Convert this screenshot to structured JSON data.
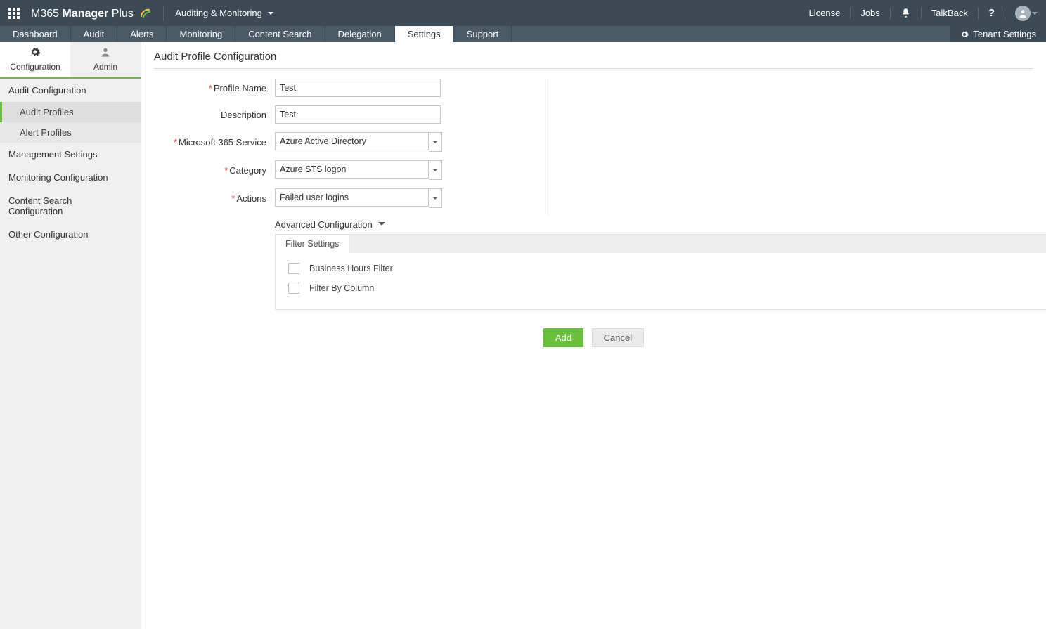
{
  "topbar": {
    "brand_pre": "M365 ",
    "brand_strong": "Manager",
    "brand_post": " Plus",
    "module": "Auditing & Monitoring",
    "license": "License",
    "jobs": "Jobs",
    "talkback": "TalkBack",
    "help": "?"
  },
  "navtabs": {
    "items": [
      "Dashboard",
      "Audit",
      "Alerts",
      "Monitoring",
      "Content Search",
      "Delegation",
      "Settings",
      "Support"
    ],
    "tenant": "Tenant Settings"
  },
  "sidetabs": {
    "configuration": "Configuration",
    "admin": "Admin"
  },
  "sidebar": {
    "audit_config": "Audit Configuration",
    "audit_profiles": "Audit Profiles",
    "alert_profiles": "Alert Profiles",
    "mgmt_settings": "Management Settings",
    "monitoring_config": "Monitoring Configuration",
    "content_search_config": "Content Search Configuration",
    "other_config": "Other Configuration"
  },
  "page": {
    "title": "Audit Profile Configuration"
  },
  "form": {
    "profile_name_label": "Profile Name",
    "profile_name_value": "Test",
    "description_label": "Description",
    "description_value": "Test",
    "service_label": "Microsoft 365 Service",
    "service_value": "Azure Active Directory",
    "category_label": "Category",
    "category_value": "Azure STS logon",
    "actions_label": "Actions",
    "actions_value": "Failed user logins",
    "advanced": "Advanced Configuration",
    "filter_tab": "Filter Settings",
    "business_hours": "Business Hours Filter",
    "filter_by_column": "Filter By Column"
  },
  "buttons": {
    "add": "Add",
    "cancel": "Cancel"
  }
}
